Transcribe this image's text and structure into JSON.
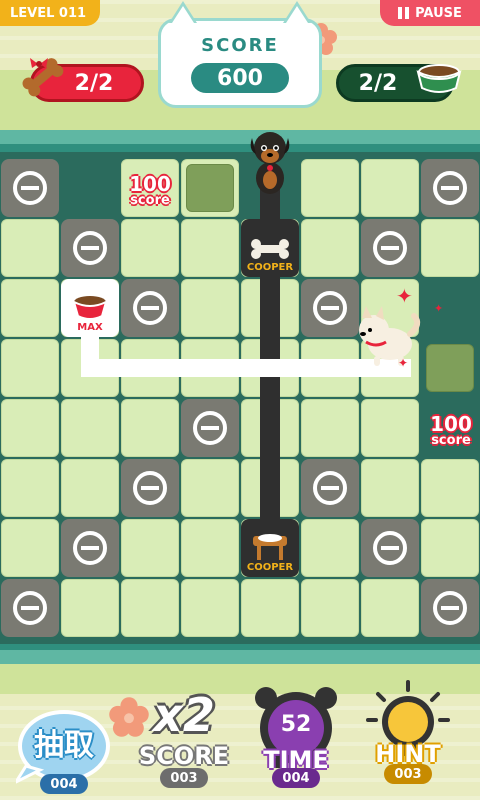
{
  "header": {
    "level": "LEVEL 011",
    "pause_label": "PAUSE",
    "score_label": "SCORE",
    "score_value": "600",
    "bones_counter": "2/2",
    "bowls_counter": "2/2",
    "icons": {
      "bones": "bones-icon",
      "bowl": "dog-bowl-icon",
      "pause": "pause-icon"
    },
    "colors": {
      "level": "#f2b21a",
      "pause": "#ef5164",
      "score": "#2a8b82",
      "bones_pill": "#e8243c",
      "bowls_pill": "#17502f"
    }
  },
  "board": {
    "cols": 8,
    "rows": 8,
    "item_labels": {
      "bowl_max": "MAX",
      "bone_cooper": "COOPER",
      "bowl_cooper": "COOPER"
    },
    "floating_scores": [
      {
        "value": "100",
        "word": "score"
      },
      {
        "value": "100",
        "word": "score"
      }
    ],
    "characters": [
      "doberman-dog",
      "shiba-dog"
    ]
  },
  "powerups": [
    {
      "name": "draw",
      "label": "抽取",
      "count": "004",
      "color": "#3fa0d8"
    },
    {
      "name": "score-x2",
      "label": "SCORE",
      "multiplier": "x2",
      "count": "003",
      "color": "#777777"
    },
    {
      "name": "time",
      "label": "TIME",
      "value": "52",
      "count": "004",
      "color": "#8a3fb0"
    },
    {
      "name": "hint",
      "label": "HINT",
      "count": "003",
      "color": "#f2b21a"
    }
  ]
}
